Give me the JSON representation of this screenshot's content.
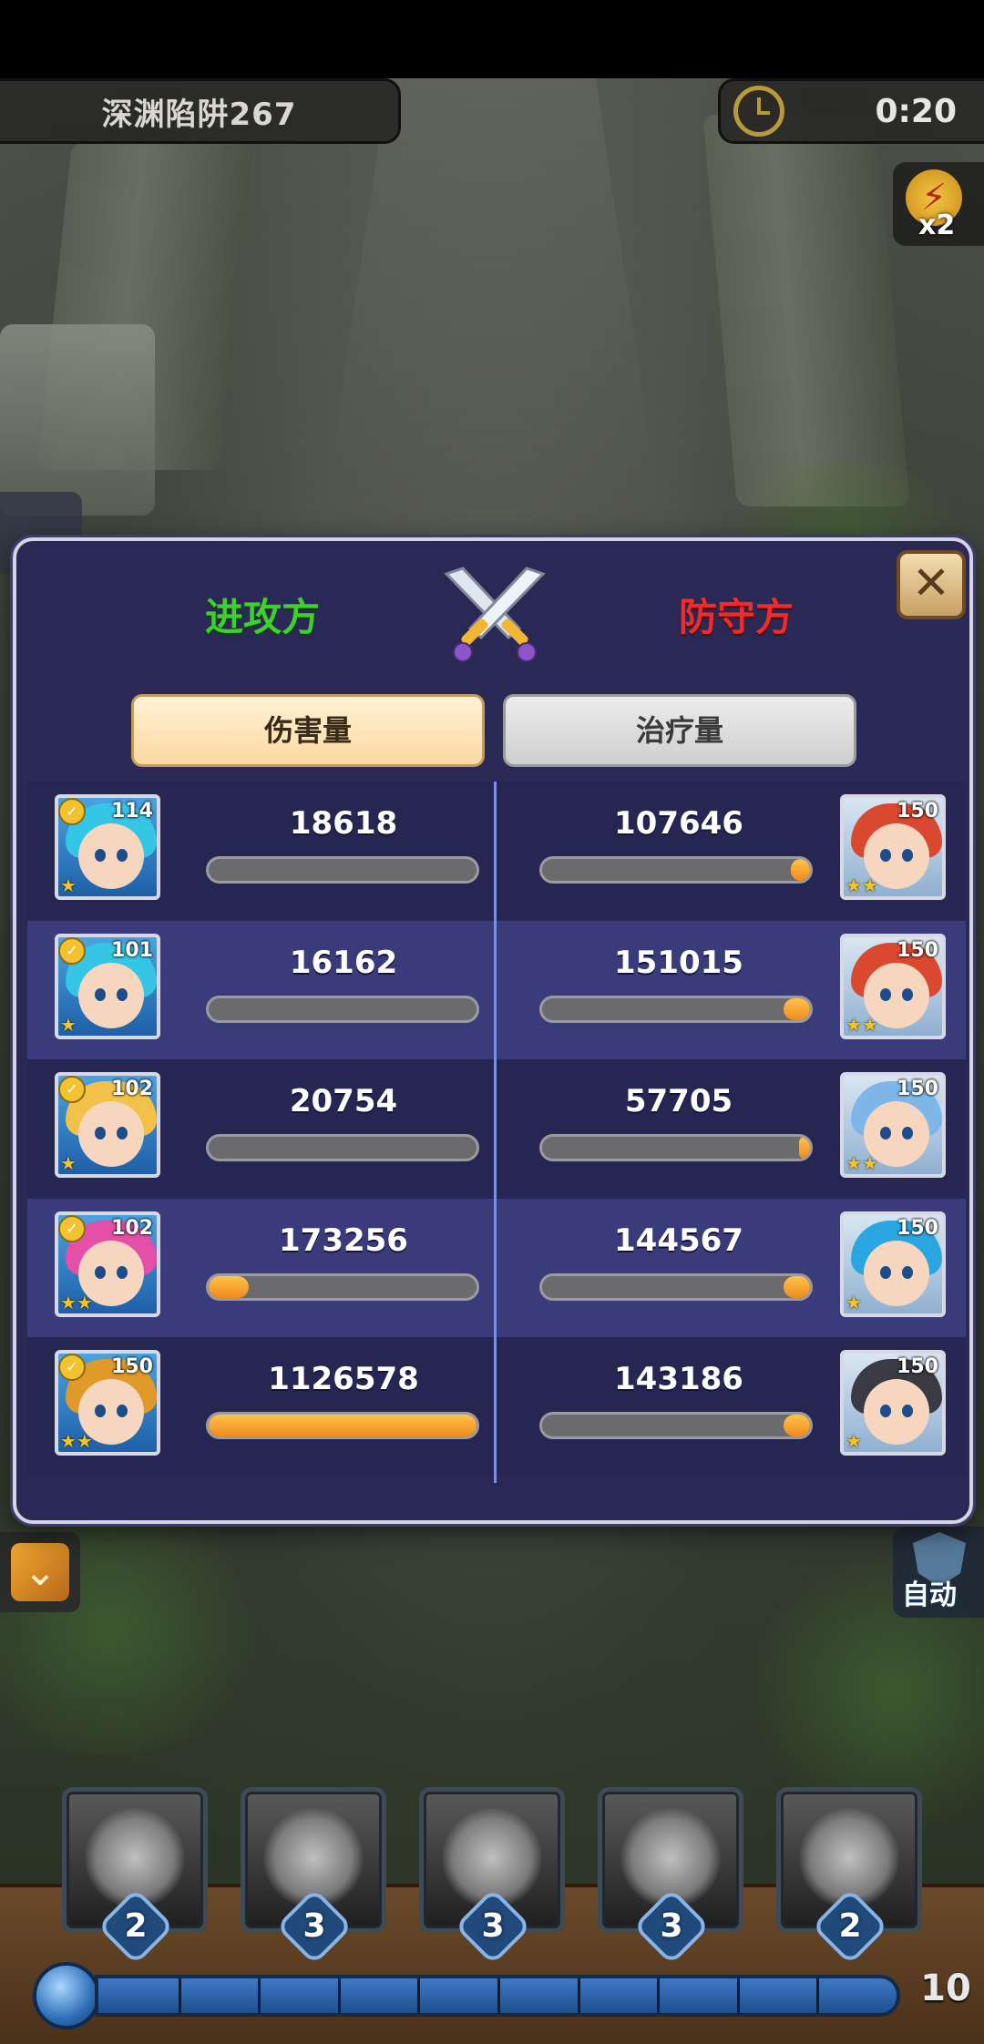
{
  "hud": {
    "level_name": "深渊陷阱267",
    "timer": "0:20",
    "speed_label": "x2",
    "auto_label": "自动",
    "icons": [
      "clock-icon",
      "lightning-icon",
      "shield-icon",
      "chevron-icon"
    ]
  },
  "panel": {
    "attacker_title": "进攻方",
    "defender_title": "防守方",
    "tabs": {
      "damage": "伤害量",
      "healing": "治疗量"
    },
    "active_tab": "damage",
    "colors": {
      "attacker": "#3fcf2f",
      "defender": "#ef2b2b",
      "bar_fill": "#f08a1e"
    },
    "attackers": [
      {
        "level": "114",
        "value": "18618",
        "bar_fraction": 0.02,
        "hair": "#35c6e6",
        "stars": 1
      },
      {
        "level": "101",
        "value": "16162",
        "bar_fraction": 0.02,
        "hair": "#35c6e6",
        "stars": 1
      },
      {
        "level": "102",
        "value": "20754",
        "bar_fraction": 0.02,
        "hair": "#f2c14a",
        "stars": 1
      },
      {
        "level": "102",
        "value": "173256",
        "bar_fraction": 0.15,
        "hair": "#e44fa8",
        "stars": 2
      },
      {
        "level": "150",
        "value": "1126578",
        "bar_fraction": 1.0,
        "hair": "#e09a2a",
        "stars": 2
      }
    ],
    "defenders": [
      {
        "level": "150",
        "value": "107646",
        "bar_fraction": 0.07,
        "hair": "#d9482f",
        "stars": 2
      },
      {
        "level": "150",
        "value": "151015",
        "bar_fraction": 0.1,
        "hair": "#d9482f",
        "stars": 2
      },
      {
        "level": "150",
        "value": "57705",
        "bar_fraction": 0.04,
        "hair": "#7fb6e8",
        "stars": 2
      },
      {
        "level": "150",
        "value": "144567",
        "bar_fraction": 0.1,
        "hair": "#2aa6e0",
        "stars": 1
      },
      {
        "level": "150",
        "value": "143186",
        "bar_fraction": 0.1,
        "hair": "#3a3a44",
        "stars": 1
      }
    ]
  },
  "skills": [
    {
      "cost": "2",
      "icon": "moon-orb-icon"
    },
    {
      "cost": "3",
      "icon": "claw-burst-icon"
    },
    {
      "cost": "3",
      "icon": "claw-burst-icon"
    },
    {
      "cost": "3",
      "icon": "arrow-strike-icon"
    },
    {
      "cost": "2",
      "icon": "comet-icon"
    }
  ],
  "energy": {
    "count": "10",
    "fraction": 1.0,
    "segments": 10
  }
}
